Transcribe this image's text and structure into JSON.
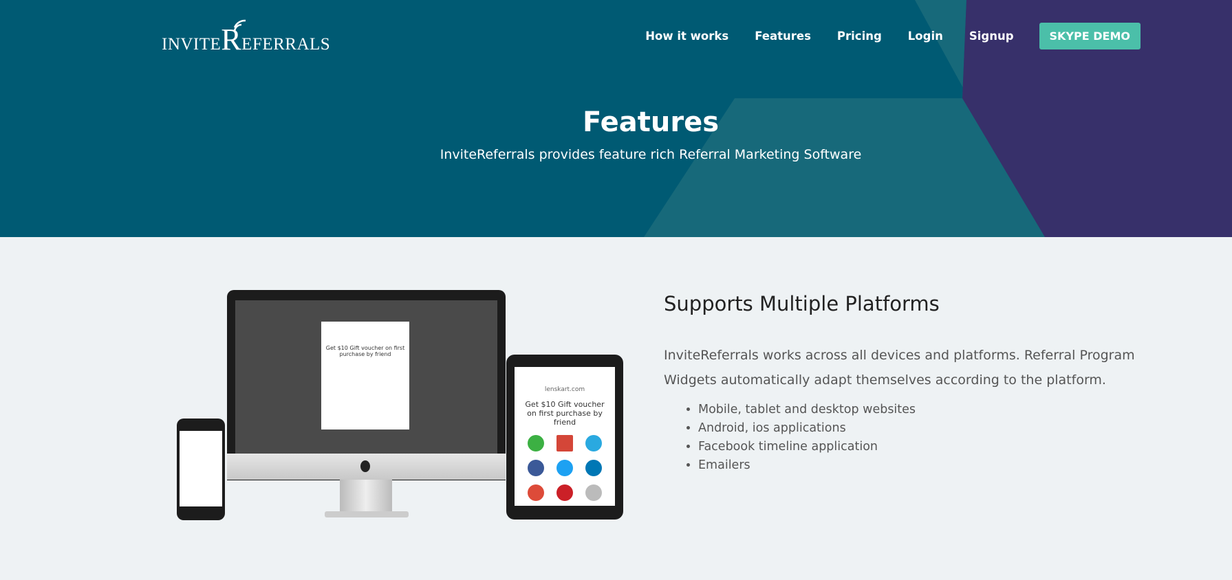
{
  "header": {
    "logo_text": "INVITE REFERRALS",
    "nav": [
      {
        "label": "How it works"
      },
      {
        "label": "Features"
      },
      {
        "label": "Pricing"
      },
      {
        "label": "Login"
      },
      {
        "label": "Signup"
      }
    ],
    "cta": "SKYPE DEMO",
    "title": "Features",
    "subtitle": "InviteReferrals provides feature rich Referral Marketing Software"
  },
  "colors": {
    "hero": "#005a73",
    "accent": "#4bbfa9",
    "purple": "#37306a"
  },
  "feature": {
    "heading": "Supports Multiple Platforms",
    "description": "InviteReferrals works across all devices and platforms. Referral Program Widgets automatically adapt themselves according to the platform.",
    "bullets": [
      "Mobile, tablet and desktop websites",
      "Android, ios applications",
      "Facebook timeline application",
      "Emailers"
    ],
    "widget": {
      "brand": "lenskart.com",
      "offer": "Get $10 Gift voucher on first purchase by friend"
    }
  }
}
